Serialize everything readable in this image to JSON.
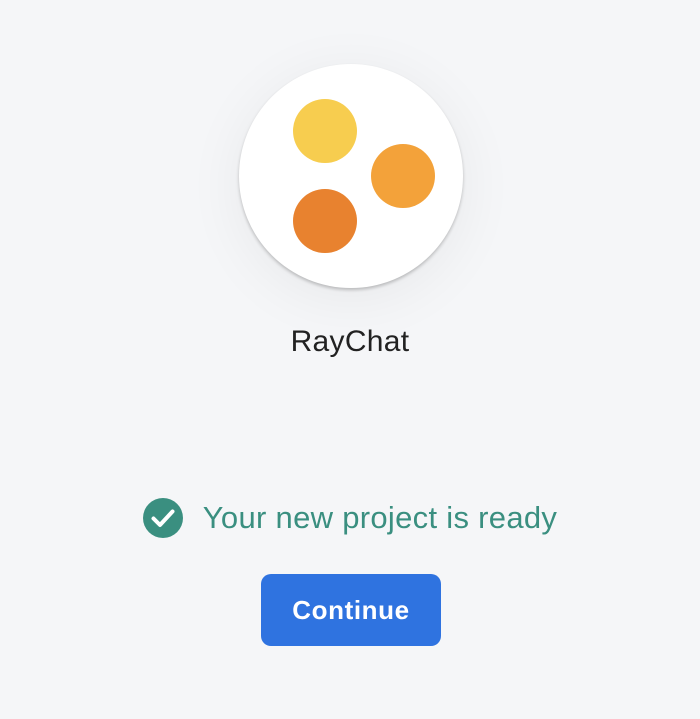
{
  "app": {
    "name": "RayChat",
    "logo": {
      "icon": "three-dots-logo",
      "dot_colors": [
        "#f7cd4f",
        "#f3a23a",
        "#e8822f"
      ]
    }
  },
  "status": {
    "icon": "check-circle-icon",
    "text": "Your new project is ready",
    "color": "#3a8f80"
  },
  "actions": {
    "continue_label": "Continue",
    "continue_color": "#2f73e0"
  }
}
